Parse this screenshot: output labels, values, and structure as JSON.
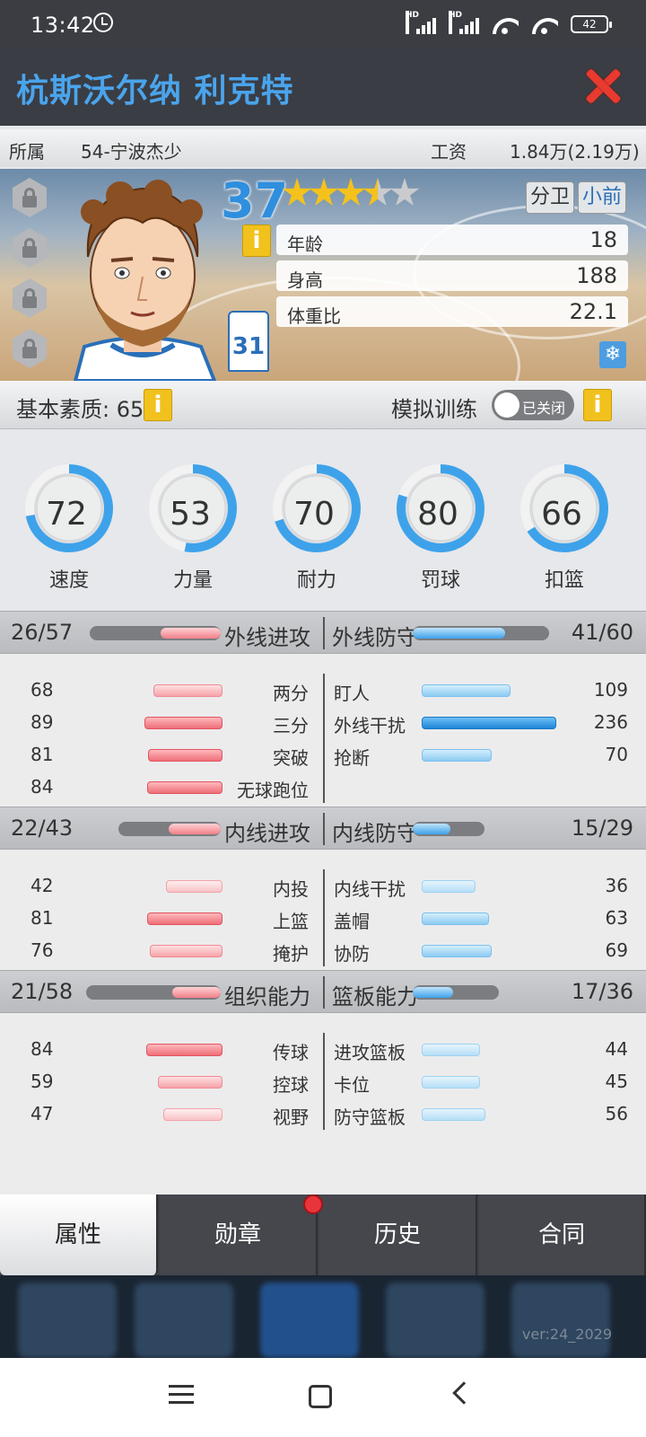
{
  "status": {
    "time": "13:42",
    "battery": "42",
    "hd1": "HD",
    "hd2": "HD"
  },
  "player": {
    "name": "杭斯沃尔纳 利克特",
    "team_label": "所属",
    "team": "54-宁波杰少",
    "salary_label": "工资",
    "salary": "1.84万(2.19万)",
    "rating": "37",
    "stars": 3.5,
    "positions": [
      "分卫",
      "小前"
    ],
    "jersey_number": "31",
    "age_label": "年龄",
    "age": "18",
    "height_label": "身高",
    "height": "188",
    "bmi_label": "体重比",
    "bmi": "22.1"
  },
  "quality": {
    "label": "基本素质: 65",
    "sim_label": "模拟训练",
    "toggle_text": "已关闭",
    "info": "i"
  },
  "circles": [
    {
      "label": "速度",
      "value": "72",
      "pct": 0.72
    },
    {
      "label": "力量",
      "value": "53",
      "pct": 0.53
    },
    {
      "label": "耐力",
      "value": "70",
      "pct": 0.7
    },
    {
      "label": "罚球",
      "value": "80",
      "pct": 0.8
    },
    {
      "label": "扣篮",
      "value": "66",
      "pct": 0.66
    }
  ],
  "sections": [
    {
      "left_score": "26/57",
      "left_title": "外线进攻",
      "left_fill": 0.46,
      "right_title": "外线防守",
      "right_score": "41/60",
      "right_fill": 0.68,
      "left_stats": [
        {
          "label": "两分",
          "value": "68",
          "fill": 0.51
        },
        {
          "label": "三分",
          "value": "89",
          "fill": 0.58
        },
        {
          "label": "突破",
          "value": "81",
          "fill": 0.55
        },
        {
          "label": "无球跑位",
          "value": "84",
          "fill": 0.56
        }
      ],
      "right_stats": [
        {
          "label": "盯人",
          "value": "109",
          "fill": 0.66
        },
        {
          "label": "外线干扰",
          "value": "236",
          "fill": 1.0
        },
        {
          "label": "抢断",
          "value": "70",
          "fill": 0.52
        }
      ]
    },
    {
      "left_score": "22/43",
      "left_title": "内线进攻",
      "left_fill": 0.51,
      "right_title": "内线防守",
      "right_score": "15/29",
      "right_fill": 0.52,
      "left_stats": [
        {
          "label": "内投",
          "value": "42",
          "fill": 0.42
        },
        {
          "label": "上篮",
          "value": "81",
          "fill": 0.56
        },
        {
          "label": "掩护",
          "value": "76",
          "fill": 0.54
        }
      ],
      "right_stats": [
        {
          "label": "内线干扰",
          "value": "36",
          "fill": 0.4
        },
        {
          "label": "盖帽",
          "value": "63",
          "fill": 0.5
        },
        {
          "label": "协防",
          "value": "69",
          "fill": 0.52
        }
      ]
    },
    {
      "left_score": "21/58",
      "left_title": "组织能力",
      "left_fill": 0.36,
      "right_title": "篮板能力",
      "right_score": "17/36",
      "right_fill": 0.47,
      "left_stats": [
        {
          "label": "传球",
          "value": "84",
          "fill": 0.57
        },
        {
          "label": "控球",
          "value": "59",
          "fill": 0.48
        },
        {
          "label": "视野",
          "value": "47",
          "fill": 0.44
        }
      ],
      "right_stats": [
        {
          "label": "进攻篮板",
          "value": "44",
          "fill": 0.43
        },
        {
          "label": "卡位",
          "value": "45",
          "fill": 0.43
        },
        {
          "label": "防守篮板",
          "value": "56",
          "fill": 0.47
        }
      ]
    }
  ],
  "tabs": [
    {
      "label": "属性",
      "active": true
    },
    {
      "label": "勋章",
      "badge": true
    },
    {
      "label": "历史"
    },
    {
      "label": "合同"
    }
  ],
  "version": "ver:24_2029",
  "colors": {
    "accent_blue": "#4aa4ec",
    "ring_blue": "#3ea2ea",
    "close_red": "#e83a2f",
    "star_gold": "#f4c21b"
  }
}
